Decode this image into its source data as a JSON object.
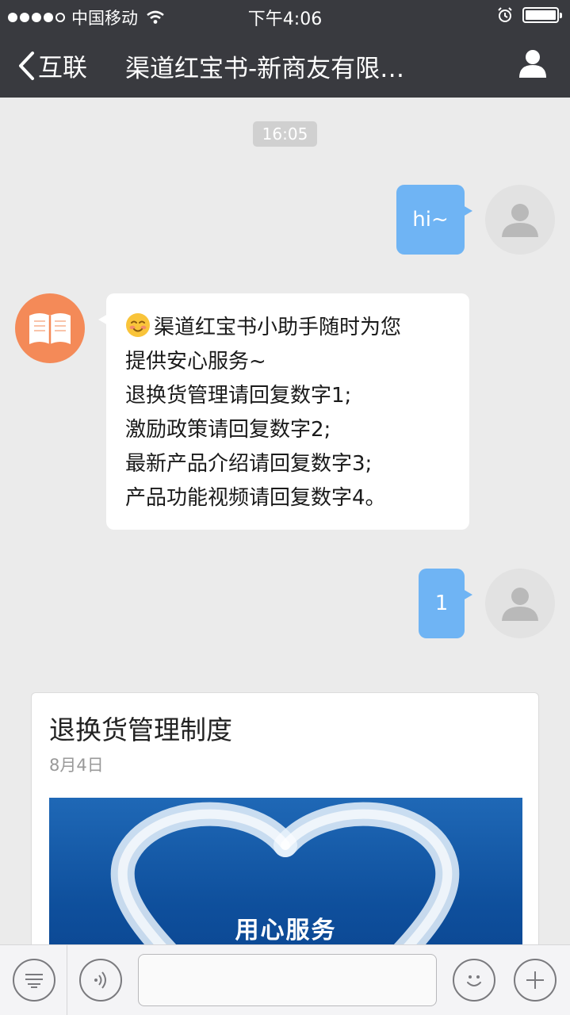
{
  "status_bar": {
    "carrier": "中国移动",
    "time": "下午4:06",
    "icons": [
      "signal-dots-icon",
      "wifi-icon",
      "alarm-icon",
      "battery-icon"
    ]
  },
  "nav": {
    "back_label": "互联",
    "title": "渠道红宝书-新商友有限…",
    "icons": [
      "chevron-left-icon",
      "profile-icon"
    ],
    "bg_color": "#393a3f"
  },
  "chat": {
    "timestamp": "16:05",
    "messages": [
      {
        "from": "me",
        "text": "hi~"
      },
      {
        "from": "bot",
        "lines": [
          "渠道红宝书小助手随时为您",
          "提供安心服务~",
          "退换货管理请回复数字1;",
          "激励政策请回复数字2;",
          "最新产品介绍请回复数字3;",
          "产品功能视频请回复数字4。"
        ]
      },
      {
        "from": "me",
        "text": "1"
      }
    ],
    "article": {
      "title": "退换货管理制度",
      "date": "8月4日",
      "cover_text": "用心服务"
    },
    "colors": {
      "outgoing_bubble": "#6fb4f4",
      "bot_avatar": "#f48a58",
      "background": "#ebebeb"
    }
  },
  "input_bar": {
    "message_value": "",
    "icons": [
      "menu-icon",
      "voice-icon",
      "emoji-icon",
      "plus-icon"
    ]
  }
}
